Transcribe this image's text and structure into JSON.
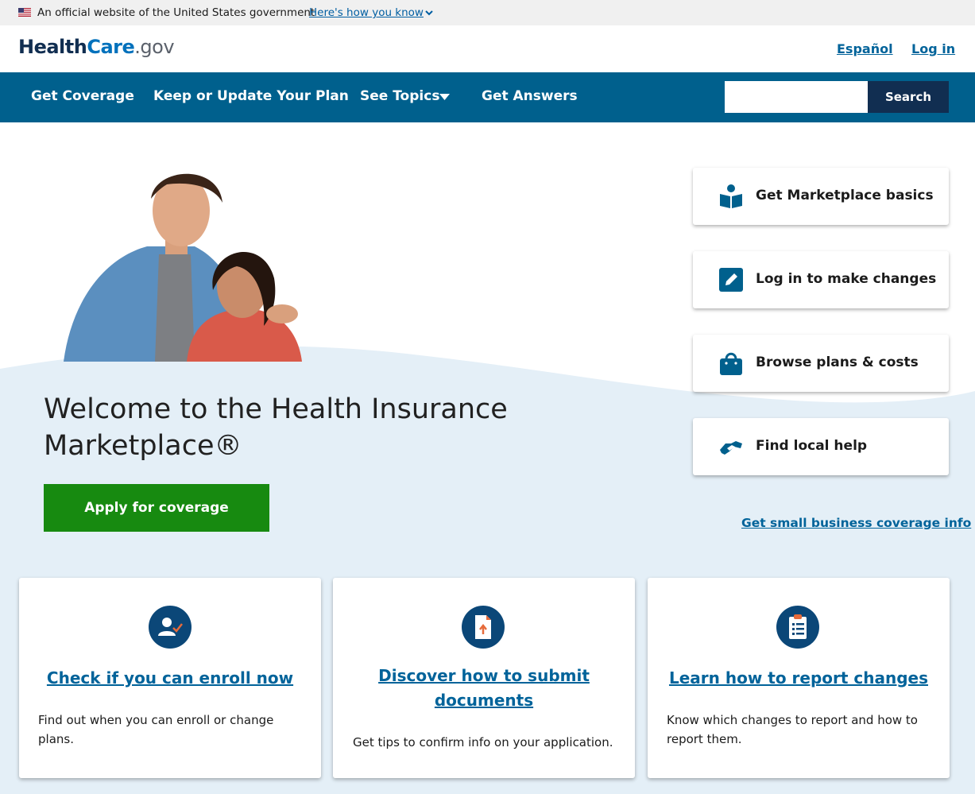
{
  "gov_banner": {
    "text": "An official website of the United States government",
    "link": "Here's how you know",
    "flag_icon": "us-flag-icon"
  },
  "header": {
    "logo": {
      "health": "Health",
      "care": "Care",
      "gov": ".gov"
    },
    "espanol": "Español",
    "login": "Log in"
  },
  "nav": {
    "items": [
      "Get Coverage",
      "Keep or Update Your Plan",
      "See Topics",
      "Get Answers"
    ],
    "search_button": "Search",
    "search_placeholder": ""
  },
  "hero": {
    "title": "Welcome to the Health Insurance Marketplace®",
    "apply_button": "Apply for coverage",
    "quick_links": [
      {
        "label": "Get Marketplace basics",
        "icon": "open-book-icon"
      },
      {
        "label": "Log in to make changes",
        "icon": "pencil-icon"
      },
      {
        "label": "Browse plans & costs",
        "icon": "shopping-bag-icon"
      },
      {
        "label": "Find local help",
        "icon": "handshake-icon"
      }
    ],
    "small_business_link": "Get small business coverage info"
  },
  "cards": [
    {
      "title": "Check if you can enroll now",
      "description": "Find out when you can enroll or change plans.",
      "icon": "user-check-icon"
    },
    {
      "title": "Discover how to submit documents",
      "description": "Get tips to confirm info on your application.",
      "icon": "document-upload-icon"
    },
    {
      "title": "Learn how to report changes",
      "description": "Know which changes to report and how to report them.",
      "icon": "clipboard-list-icon"
    }
  ],
  "colors": {
    "nav_bg": "#00608d",
    "search_btn": "#112e51",
    "apply_btn": "#178a10",
    "link": "#00639a",
    "hero_wave": "#e4eff7",
    "icon_circle": "#0b4778",
    "accent_orange": "#e66b3b"
  }
}
